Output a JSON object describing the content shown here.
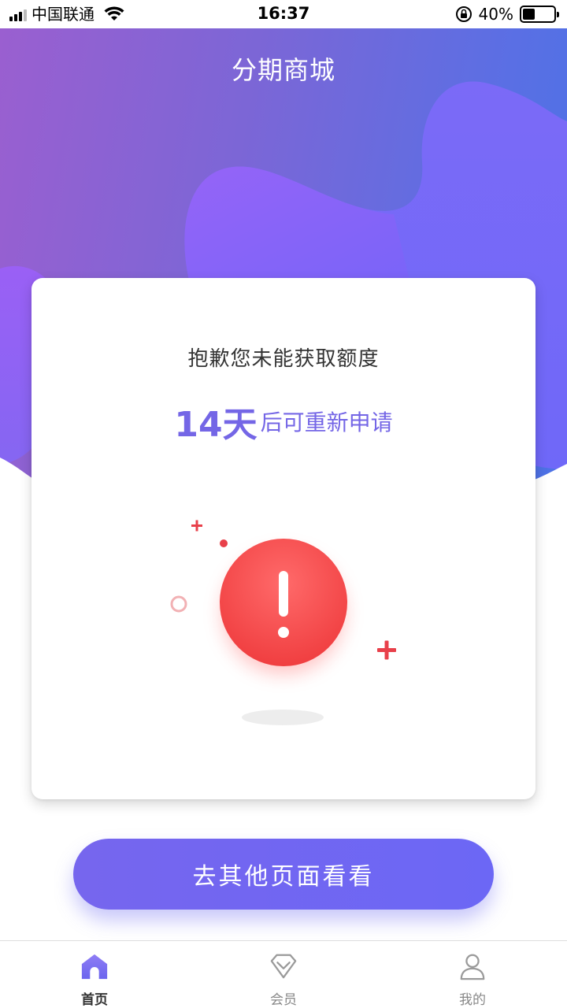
{
  "status_bar": {
    "carrier": "中国联通",
    "time": "16:37",
    "battery": "40%",
    "battery_level": 0.4
  },
  "header": {
    "title": "分期商城"
  },
  "card": {
    "message": "抱歉您未能获取额度",
    "days": "14天",
    "reapply_text": "后可重新申请",
    "icon": "exclamation-icon"
  },
  "cta": {
    "label": "去其他页面看看"
  },
  "tabs": [
    {
      "label": "首页",
      "icon": "home-icon",
      "active": true
    },
    {
      "label": "会员",
      "icon": "diamond-icon",
      "active": false
    },
    {
      "label": "我的",
      "icon": "user-icon",
      "active": false
    }
  ],
  "colors": {
    "accent": "#7466e6",
    "alert": "#f24949",
    "header_gradient_start": "#9a5fd0",
    "header_gradient_end": "#4b72e6"
  }
}
